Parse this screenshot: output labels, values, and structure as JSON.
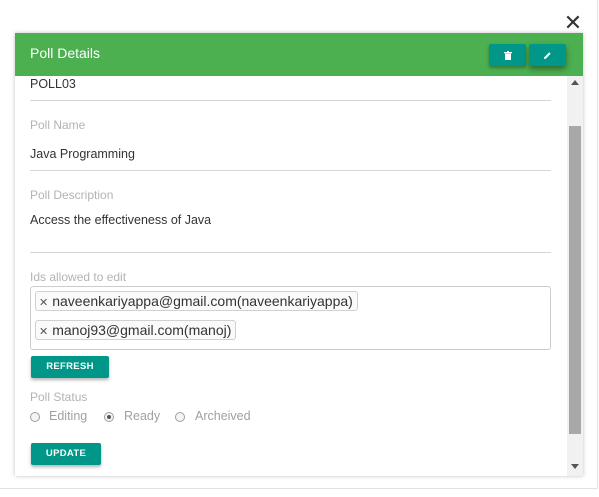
{
  "dialog": {
    "title": "Poll Details",
    "close_icon": "close-icon",
    "header_buttons": [
      {
        "icon": "trash-icon"
      },
      {
        "icon": "pencil-icon"
      }
    ],
    "colors": {
      "header": "#4caf50",
      "button": "#009688"
    }
  },
  "form": {
    "poll_id": "POLL03",
    "poll_name_label": "Poll Name",
    "poll_name": "Java Programming",
    "poll_description_label": "Poll Description",
    "poll_description": "Access the effectiveness of Java",
    "ids_label": "Ids allowed to edit",
    "ids": [
      "naveenkariyappa@gmail.com(naveenkariyappa)",
      "manoj93@gmail.com(manoj)"
    ],
    "refresh_label": "REFRESH",
    "status_label": "Poll Status",
    "status_options": [
      "Editing",
      "Ready",
      "Archeived"
    ],
    "status_selected": "Ready",
    "update_label": "UPDATE"
  }
}
